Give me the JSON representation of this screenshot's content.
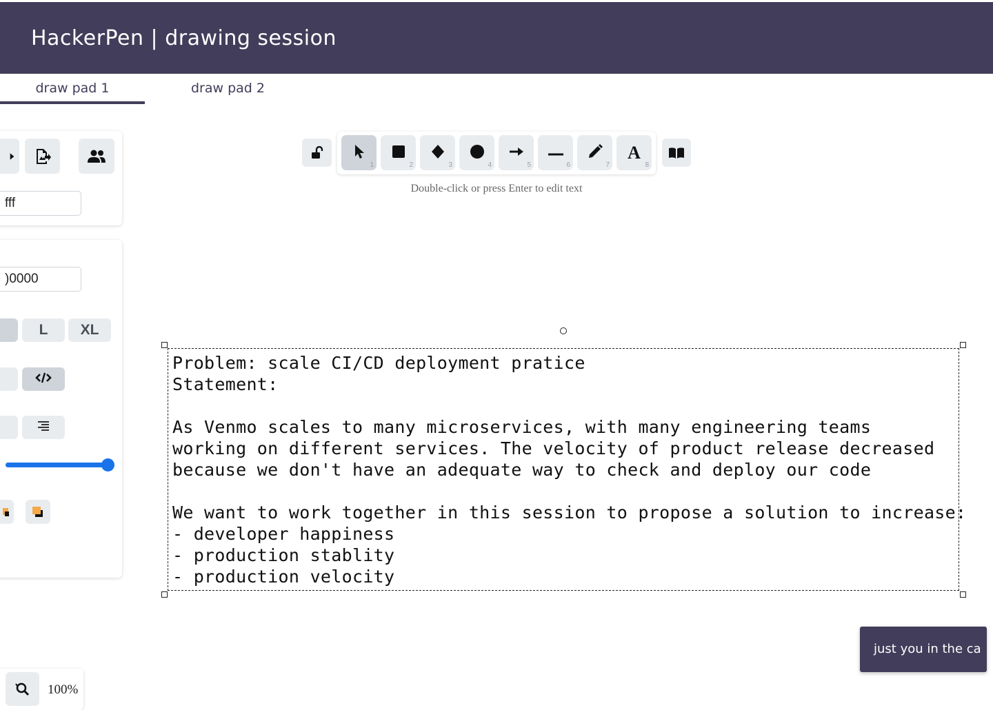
{
  "header": {
    "title": "HackerPen | drawing session",
    "background": "#413d5a"
  },
  "tabs": [
    {
      "label": "draw pad 1",
      "active": true
    },
    {
      "label": "draw pad 2",
      "active": false
    }
  ],
  "left_panel": {
    "top_actions": [
      "export-icon",
      "export-image-icon",
      "collaborators-icon"
    ],
    "background_field_value": "fff",
    "stroke_field_value": ")0000",
    "font_sizes": [
      "L",
      "XL"
    ],
    "font_family_icon": "code-icon",
    "text_align_icon": "align-right-icon",
    "opacity_percent": 100,
    "layer_icons": [
      "send-backward-icon",
      "bring-forward-icon"
    ]
  },
  "toolbar": {
    "lock_icon": "unlock-icon",
    "tools": [
      {
        "icon": "pointer-icon",
        "key": "1",
        "selected": true
      },
      {
        "icon": "rectangle-icon",
        "key": "2"
      },
      {
        "icon": "diamond-icon",
        "key": "3"
      },
      {
        "icon": "ellipse-icon",
        "key": "4"
      },
      {
        "icon": "arrow-icon",
        "key": "5"
      },
      {
        "icon": "line-icon",
        "key": "6"
      },
      {
        "icon": "pencil-icon",
        "key": "7"
      },
      {
        "icon": "text-icon",
        "key": "8"
      }
    ],
    "library_icon": "library-icon",
    "hint": "Double-click or press Enter to edit text"
  },
  "canvas": {
    "text_lines": [
      "Problem: scale CI/CD deployment pratice",
      "Statement:",
      "",
      "As Venmo scales to many microservices, with many engineering teams",
      "working on different services. The velocity of product release decreased",
      "because we don't have an adequate way to check and deploy our code",
      "",
      "We want to work together in this session to propose a solution to increase:",
      "- developer happiness",
      "- production stablity",
      "- production velocity"
    ]
  },
  "toast": {
    "text": "just you in the ca"
  },
  "zoom": {
    "label": "100%"
  }
}
